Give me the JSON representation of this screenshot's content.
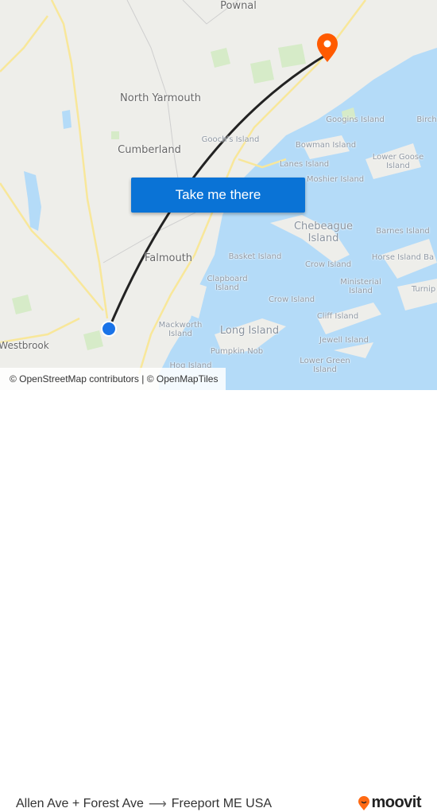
{
  "map": {
    "labels": {
      "pownal": "Pownal",
      "north_yarmouth": "North Yarmouth",
      "cumberland": "Cumberland",
      "falmouth": "Falmouth",
      "westbrook": "Westbrook",
      "goochs": "Gooch's Island",
      "googins": "Googins Island",
      "birch": "Birch",
      "bowman": "Bowman Island",
      "lower_goose": "Lower Goose Island",
      "lanes": "Lanes Island",
      "moshier": "Moshier Island",
      "chebeague": "Chebeague Island",
      "barnes": "Barnes Island",
      "basket": "Basket Island",
      "crow1": "Crow Island",
      "horse": "Horse Island Ba",
      "clapboard": "Clapboard Island",
      "ministerial": "Ministerial Island",
      "turnip": "Turnip",
      "crow2": "Crow Island",
      "cliff": "Cliff Island",
      "long": "Long Island",
      "mackworth": "Mackworth Island",
      "jewell": "Jewell Island",
      "pumpkin": "Pumpkin Nob",
      "lower_green": "Lower Green Island",
      "hog": "Hog Island"
    },
    "colors": {
      "water": "#b4dbf8",
      "land": "#eeeeea",
      "route": "#222222",
      "origin": "#1a73e8",
      "destination": "#ff5a00",
      "button": "#0a73d6"
    },
    "origin_icon": "origin-dot-icon",
    "destination_icon": "destination-pin-icon"
  },
  "cta": {
    "label": "Take me there"
  },
  "attribution": "© OpenStreetMap contributors | © OpenMapTiles",
  "footer": {
    "from": "Allen Ave + Forest Ave",
    "arrow": "⟶",
    "to": "Freeport ME USA",
    "logo_text": "moovit"
  }
}
